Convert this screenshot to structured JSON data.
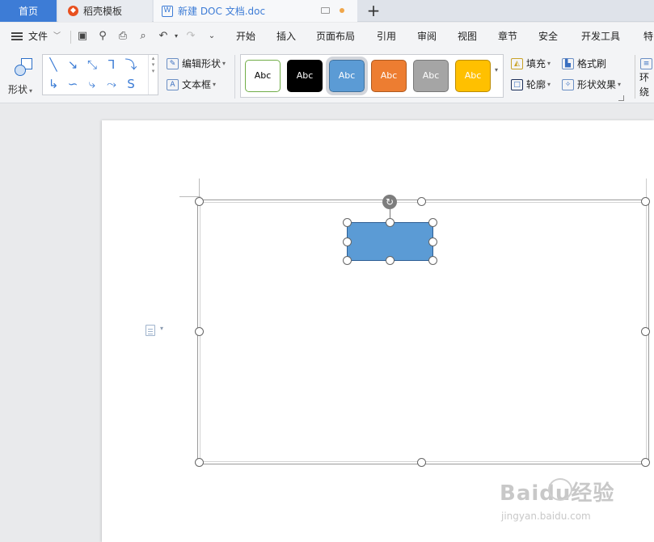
{
  "tabs": {
    "home": "首页",
    "template": "稻壳模板",
    "doc": "新建 DOC 文档.doc",
    "new_tab": "+"
  },
  "menu": {
    "file": "文件",
    "items": [
      "开始",
      "插入",
      "页面布局",
      "引用",
      "审阅",
      "视图",
      "章节",
      "安全",
      "开发工具",
      "特"
    ]
  },
  "ribbon": {
    "shapes_label": "形状",
    "edit_shape": "编辑形状",
    "textbox": "文本框",
    "style_label": "Abc",
    "fill": "填充",
    "format_painter": "格式刷",
    "outline": "轮廓",
    "shape_effects": "形状效果",
    "wrap": "环绕"
  },
  "styles": [
    {
      "bg": "#ffffff",
      "border": "#70ad47",
      "text": "#000000"
    },
    {
      "bg": "#000000",
      "border": "#000000",
      "text": "#ffffff"
    },
    {
      "bg": "#5b9bd5",
      "border": "#41719c",
      "text": "#ffffff",
      "selected": true
    },
    {
      "bg": "#ed7d31",
      "border": "#ae5a21",
      "text": "#ffffff"
    },
    {
      "bg": "#a5a5a5",
      "border": "#787878",
      "text": "#ffffff"
    },
    {
      "bg": "#ffc000",
      "border": "#bc8c00",
      "text": "#ffffff"
    }
  ],
  "colors": {
    "accent": "#3d7cd6",
    "shape_fill": "#5b9bd5",
    "shape_border": "#2f5f94"
  },
  "watermark": {
    "brand": "Baidu经验",
    "url": "jingyan.baidu.com"
  }
}
